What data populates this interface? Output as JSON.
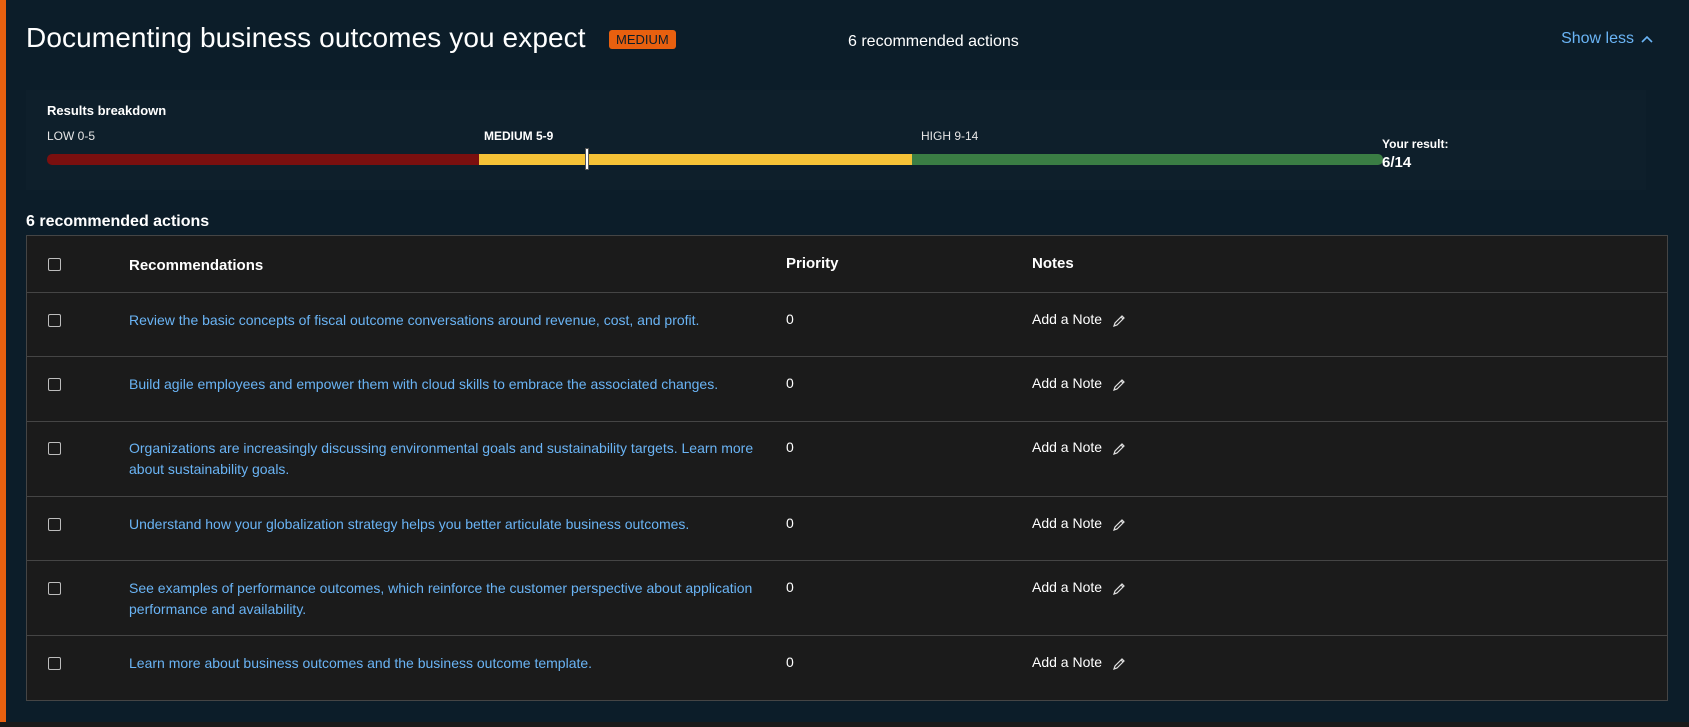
{
  "header": {
    "title": "Documenting business outcomes you expect",
    "badge": "MEDIUM",
    "recommended_count_label": "6 recommended actions",
    "toggle_label": "Show less",
    "accent_color": "#e8600f"
  },
  "breakdown": {
    "title": "Results breakdown",
    "ranges": [
      {
        "label": "LOW 0-5",
        "color": "#7a0f0f"
      },
      {
        "label": "MEDIUM 5-9",
        "color": "#f5c237"
      },
      {
        "label": "HIGH 9-14",
        "color": "#3a7d44"
      }
    ],
    "result_label": "Your result:",
    "result_value": "6/14",
    "score": 6,
    "max_score": 14
  },
  "section": {
    "heading": "6 recommended actions"
  },
  "table": {
    "columns": {
      "recommendations": "Recommendations",
      "priority": "Priority",
      "notes": "Notes"
    },
    "rows": [
      {
        "text": "Review the basic concepts of fiscal outcome conversations around revenue, cost, and profit.",
        "priority": "0",
        "note": "Add a Note"
      },
      {
        "text": "Build agile employees and empower them with cloud skills to embrace the associated changes.",
        "priority": "0",
        "note": "Add a Note"
      },
      {
        "text": "Organizations are increasingly discussing environmental goals and sustainability targets. Learn more about sustainability goals.",
        "priority": "0",
        "note": "Add a Note"
      },
      {
        "text": "Understand how your globalization strategy helps you better articulate business outcomes.",
        "priority": "0",
        "note": "Add a Note"
      },
      {
        "text": "See examples of performance outcomes, which reinforce the customer perspective about application performance and availability.",
        "priority": "0",
        "note": "Add a Note"
      },
      {
        "text": "Learn more about business outcomes and the business outcome template.",
        "priority": "0",
        "note": "Add a Note"
      }
    ]
  },
  "icons": {
    "toggle": "chevron-up-icon",
    "note": "pencil-icon"
  }
}
